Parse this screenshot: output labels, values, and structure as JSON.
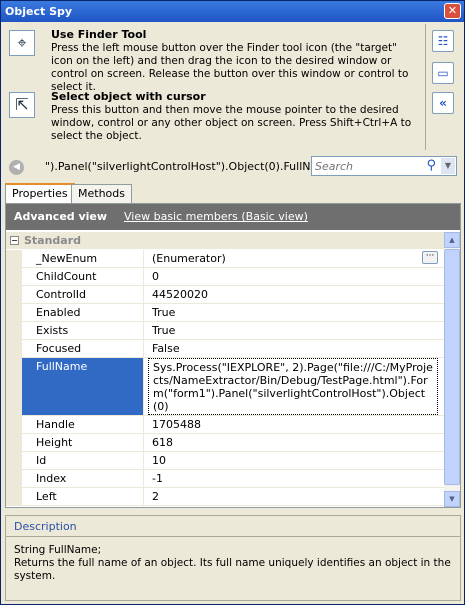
{
  "window": {
    "title": "Object Spy",
    "close_label": "✕"
  },
  "finder": {
    "title": "Use Finder Tool",
    "description": "Press the left mouse button over the Finder tool icon (the \"target\" icon on the left) and then drag the icon to the desired  window or control on screen. Release the button over this window or control to select it.",
    "icon_glyph": "⌖"
  },
  "cursor_select": {
    "title": "Select object with cursor",
    "description": "Press this button and then move the mouse pointer to the desired window, control or any other object on screen. Press Shift+Ctrl+A to select the object.",
    "icon_glyph": "⇱"
  },
  "side_buttons": [
    {
      "icon": "tree-view-icon",
      "glyph": "☷"
    },
    {
      "icon": "window-icon",
      "glyph": "▭"
    },
    {
      "icon": "collapse-icon",
      "glyph": "«"
    }
  ],
  "path": {
    "back_glyph": "◀",
    "text": "\").Panel(\"silverlightControlHost\").Object(0).FullName"
  },
  "search": {
    "placeholder": "Search",
    "icon_glyph": "⚲",
    "drop_glyph": "▼"
  },
  "tabs": [
    {
      "label": "Properties"
    },
    {
      "label": "Methods"
    }
  ],
  "view": {
    "title": "Advanced view",
    "link": "View basic members (Basic view)"
  },
  "grid": {
    "group": {
      "label": "Standard",
      "toggle": "−"
    },
    "rows": [
      {
        "name": "_NewEnum",
        "value": "(Enumerator)",
        "has_button": true
      },
      {
        "name": "ChildCount",
        "value": "0"
      },
      {
        "name": "ControlId",
        "value": "44520020"
      },
      {
        "name": "Enabled",
        "value": "True"
      },
      {
        "name": "Exists",
        "value": "True"
      },
      {
        "name": "Focused",
        "value": "False"
      },
      {
        "name": "FullName",
        "value": "Sys.Process(\"IEXPLORE\", 2).Page(\"file:///C:/MyProjects/NameExtractor/Bin/Debug/TestPage.html\").Form(\"form1\").Panel(\"silverlightControlHost\").Object(0)",
        "selected": true
      },
      {
        "name": "Handle",
        "value": "1705488"
      },
      {
        "name": "Height",
        "value": "618"
      },
      {
        "name": "Id",
        "value": "10"
      },
      {
        "name": "Index",
        "value": "-1"
      },
      {
        "name": "Left",
        "value": "2"
      }
    ],
    "button_label": "···"
  },
  "scroll": {
    "up": "▲",
    "down": "▼"
  },
  "description": {
    "title": "Description",
    "body_line1": "String FullName;",
    "body_line2": "Returns the full name of an object.  Its full name uniquely identifies an object in the system."
  }
}
